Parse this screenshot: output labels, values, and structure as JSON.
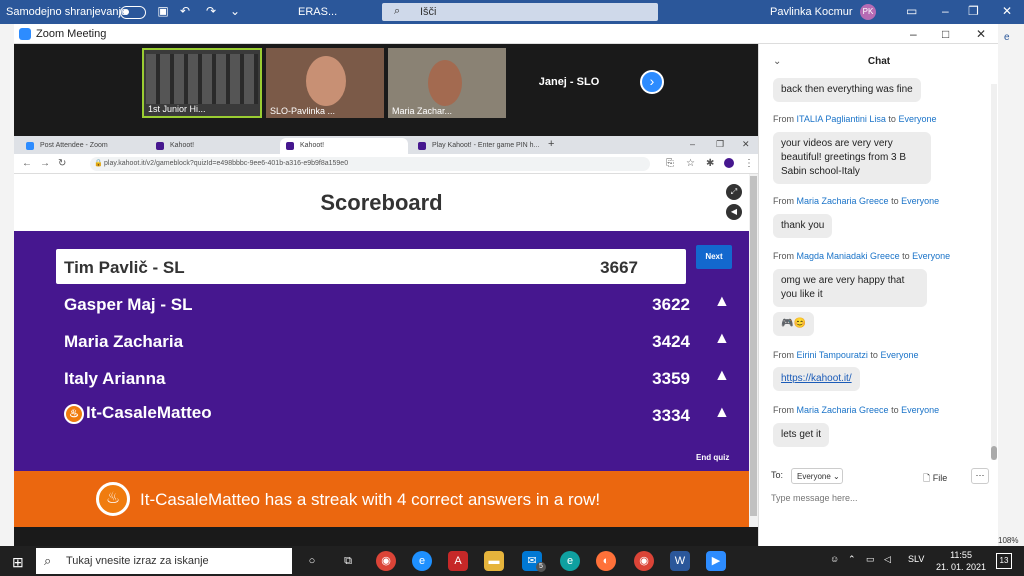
{
  "word": {
    "autosave_label": "Samodejno shranjevanje",
    "doc_title": "ERAS...",
    "search_placeholder": "Išči",
    "user_name": "Pavlinka Kocmur",
    "user_initials": "PK",
    "right_label": "e",
    "zoom_percent": "108%"
  },
  "zoom": {
    "window_title": "Zoom Meeting",
    "participants": [
      {
        "name": "1st Junior Hi..."
      },
      {
        "name": "SLO-Pavlinka ..."
      },
      {
        "name": "Maria Zachar..."
      },
      {
        "name": "Janej - SLO"
      }
    ]
  },
  "browser": {
    "tabs": [
      {
        "label": "Post Attendee - Zoom"
      },
      {
        "label": "Kahoot!"
      },
      {
        "label": "Kahoot!"
      },
      {
        "label": "Play Kahoot! - Enter game PIN h..."
      }
    ],
    "url": "play.kahoot.it/v2/gameblock?quizId=e498bbbc-9ee6-401b-a316-e9b9f8a159e0"
  },
  "kahoot": {
    "title": "Scoreboard",
    "next_label": "Next",
    "end_quiz_label": "End quiz",
    "rows": [
      {
        "name": "Tim Pavlič - SL",
        "score": "3667"
      },
      {
        "name": "Gasper Maj - SL",
        "score": "3622"
      },
      {
        "name": "Maria Zacharia",
        "score": "3424"
      },
      {
        "name": "Italy Arianna",
        "score": "3359"
      },
      {
        "name": "It-CasaleMatteo",
        "score": "3334"
      }
    ],
    "streak_text": "It-CasaleMatteo has a streak with 4 correct answers in a row!"
  },
  "chat": {
    "title": "Chat",
    "messages": [
      {
        "from": "",
        "to": "",
        "text": "back then everything was fine"
      },
      {
        "from": "ITALIA Pagliantini Lisa",
        "to": "Everyone",
        "text": "your videos are very very beautiful! greetings from 3 B Sabin school-Italy"
      },
      {
        "from": "Maria Zacharia Greece",
        "to": "Everyone",
        "text": "thank you"
      },
      {
        "from": "Magda Maniadaki Greece",
        "to": "Everyone",
        "text": "omg we are very happy that you like it"
      },
      {
        "from": "",
        "to": "",
        "text": "🎮😊"
      },
      {
        "from": "Eirini Tampouratzi",
        "to": "Everyone",
        "text": "https://kahoot.it/"
      },
      {
        "from": "Maria Zacharia Greece",
        "to": "Everyone",
        "text": "lets get it"
      }
    ],
    "from_word": "From",
    "to_word": "to",
    "to_label": "To:",
    "to_value": "Everyone",
    "file_label": "File",
    "input_placeholder": "Type message here..."
  },
  "taskbar": {
    "search_placeholder": "Tukaj vnesite izraz za iskanje",
    "language": "SLV",
    "time": "11:55",
    "date": "21. 01. 2021",
    "notification_count": "13",
    "mail_badge": "5"
  }
}
